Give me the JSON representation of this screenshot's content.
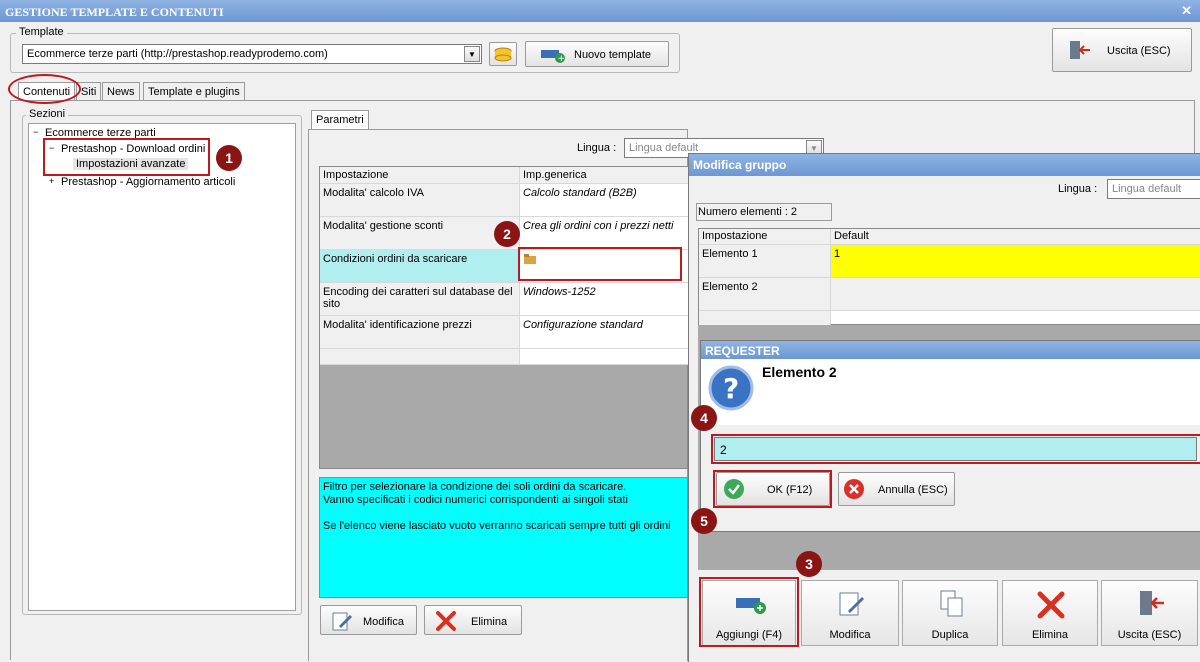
{
  "window": {
    "title": "GESTIONE TEMPLATE E CONTENUTI",
    "close_glyph": "✕"
  },
  "template_group": {
    "label": "Template",
    "selected": "Ecommerce terze parti (http://prestashop.readyprodemo.com)",
    "new_button": "Nuovo template"
  },
  "exit_button": "Uscita (ESC)",
  "tabs": [
    "Contenuti",
    "Siti",
    "News",
    "Template e plugins"
  ],
  "sections": {
    "label": "Sezioni",
    "tree": {
      "root": "Ecommerce terze parti",
      "node1": "Prestashop - Download ordini",
      "node1_child": "Impostazioni avanzate",
      "node2": "Prestashop - Aggiornamento articoli"
    }
  },
  "params": {
    "tab": "Parametri",
    "lingua_label": "Lingua :",
    "lingua_value": "Lingua default",
    "headers": [
      "Impostazione",
      "Imp.generica"
    ],
    "rows": [
      {
        "name": "Modalita' calcolo IVA",
        "value": "Calcolo standard (B2B)"
      },
      {
        "name": "Modalita' gestione sconti",
        "value": "Crea gli ordini con i prezzi netti"
      },
      {
        "name": "Condizioni ordini da scaricare",
        "value": ""
      },
      {
        "name": "Encoding dei caratteri sul database del sito",
        "value": "Windows-1252"
      },
      {
        "name": "Modalita' identificazione prezzi",
        "value": "Configurazione standard"
      }
    ],
    "description": [
      "Filtro per selezionare la condizione dei soli ordini da scaricare.",
      "Vanno specificati i codici numerici corrispondenti ai singoli stati",
      "",
      "Se l'elenco viene lasciato vuoto verranno scaricati sempre tutti gli ordini"
    ],
    "modifica": "Modifica",
    "elimina": "Elimina"
  },
  "group_dialog": {
    "title": "Modifica gruppo",
    "lingua_label": "Lingua :",
    "lingua_value": "Lingua default",
    "count": "Numero elementi : 2",
    "headers": [
      "Impostazione",
      "Default"
    ],
    "rows": [
      {
        "name": "Elemento 1",
        "value": "1"
      },
      {
        "name": "Elemento 2",
        "value": ""
      }
    ],
    "buttons": [
      "Aggiungi (F4)",
      "Modifica",
      "Duplica",
      "Elimina",
      "Uscita (ESC)"
    ]
  },
  "requester": {
    "title": "REQUESTER",
    "message": "Elemento 2",
    "input_value": "2",
    "ok": "OK (F12)",
    "cancel": "Annulla (ESC)"
  },
  "badges": [
    "1",
    "2",
    "3",
    "4",
    "5"
  ],
  "colors": {
    "accent_red": "#c0181f",
    "badge": "#8b1414",
    "cyan": "#b0eef0",
    "yellow": "#ffff00",
    "desc_cyan": "#00ffff"
  }
}
